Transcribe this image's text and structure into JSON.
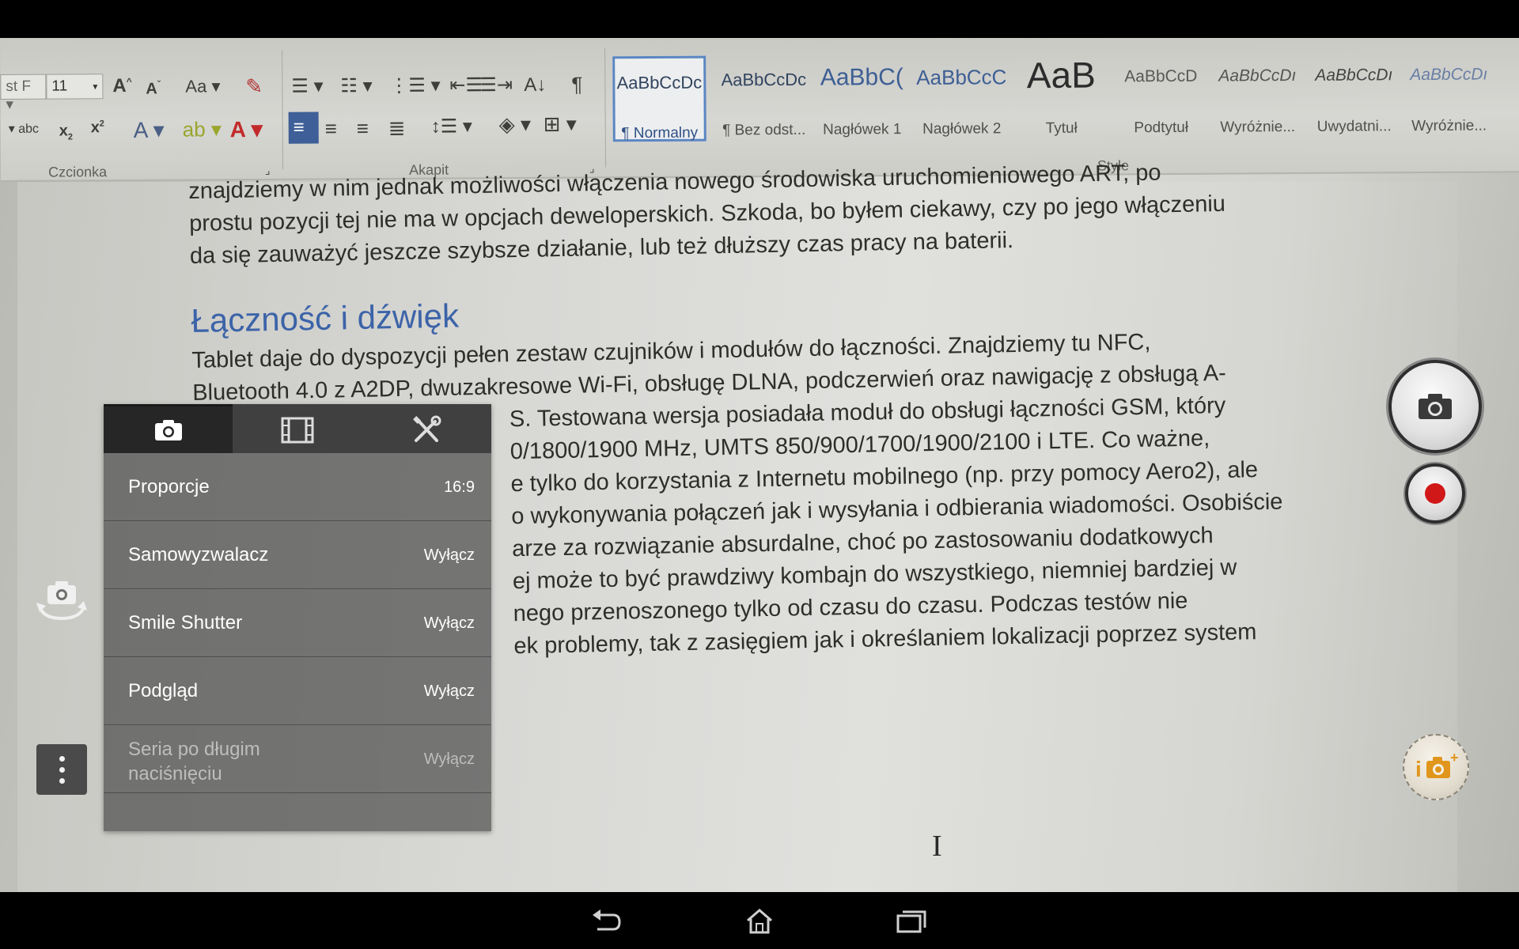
{
  "ribbon": {
    "font_size": "11",
    "group_font": "Czcionka",
    "group_paragraph": "Akapit",
    "group_styles": "Style",
    "styles": [
      {
        "sample": "AaBbCcDc",
        "name": "¶ Normalny"
      },
      {
        "sample": "AaBbCcDc",
        "name": "¶ Bez odst..."
      },
      {
        "sample": "AaBbC(",
        "name": "Nagłówek 1"
      },
      {
        "sample": "AaBbCcC",
        "name": "Nagłówek 2"
      },
      {
        "sample": "AaB",
        "name": "Tytuł"
      },
      {
        "sample": "AaBbCcD",
        "name": "Podtytuł"
      },
      {
        "sample": "AaBbCcDı",
        "name": "Wyróżnie..."
      },
      {
        "sample": "AaBbCcDı",
        "name": "Uwydatni..."
      },
      {
        "sample": "AaBbCcDı",
        "name": "Wyróżnie..."
      }
    ]
  },
  "document": {
    "para1": [
      "znajdziemy w nim jednak możliwości włączenia nowego środowiska uruchomieniowego ART, po",
      "prostu pozycji tej nie ma w opcjach deweloperskich. Szkoda, bo byłem ciekawy, czy po jego włączeniu",
      "da się zauważyć jeszcze szybsze działanie, lub też dłuższy czas pracy na baterii."
    ],
    "heading": "Łączność i dźwięk",
    "para2": [
      "Tablet daje do dyspozycji pełen zestaw czujników i modułów do łączności. Znajdziemy tu NFC,",
      "Bluetooth 4.0 z A2DP, dwuzakresowe Wi-Fi, obsługę DLNA, podczerwień oraz nawigację z obsługą A-",
      "S. Testowana wersja posiadała moduł do obsługi łączności GSM, który",
      "0/1800/1900 MHz, UMTS 850/900/1700/1900/2100 i LTE. Co ważne,",
      "e tylko do korzystania z Internetu mobilnego (np. przy pomocy Aero2), ale",
      "o wykonywania połączeń jak i wysyłania i odbierania wiadomości. Osobiście",
      "arze za rozwiązanie absurdalne, choć po zastosowaniu dodatkowych",
      "ej może to być prawdziwy kombajn do wszystkiego, niemniej bardziej w",
      "nego przenoszonego tylko od czasu do czasu. Podczas testów nie",
      "ek problemy, tak z zasięgiem jak i określaniem lokalizacji poprzez system"
    ]
  },
  "camera_menu": {
    "rows": [
      {
        "label": "Proporcje",
        "value": "16:9"
      },
      {
        "label": "Samowyzwalacz",
        "value": "Wyłącz"
      },
      {
        "label": "Smile Shutter",
        "value": "Wyłącz"
      },
      {
        "label": "Podgląd",
        "value": "Wyłącz"
      },
      {
        "label": "Seria po długim naciśnięciu",
        "value": "Wyłącz"
      }
    ]
  },
  "mode_button": {
    "label": "i"
  },
  "icons": {
    "tabs": [
      "camera-icon",
      "film-icon",
      "tools-icon"
    ],
    "nav": [
      "back-icon",
      "home-icon",
      "recent-apps-icon"
    ]
  },
  "colors": {
    "record": "#d11818",
    "heading": "#3b63a8",
    "selected_style": "#5b86c2"
  }
}
